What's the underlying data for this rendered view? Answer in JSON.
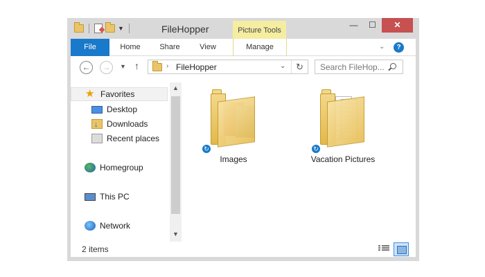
{
  "window": {
    "title": "FileHopper",
    "context_tab": "Picture Tools",
    "min_label": "—",
    "max_label": "☐",
    "close_label": "✕"
  },
  "ribbon": {
    "tabs": [
      "File",
      "Home",
      "Share",
      "View",
      "Manage"
    ],
    "expand_label": "⌄",
    "help_label": "?"
  },
  "address": {
    "path": "FileHopper",
    "search_placeholder": "Search FileHop..."
  },
  "nav": {
    "favorites": "Favorites",
    "items": [
      "Desktop",
      "Downloads",
      "Recent places"
    ],
    "homegroup": "Homegroup",
    "this_pc": "This PC",
    "network": "Network"
  },
  "content": {
    "items": [
      {
        "name": "Images",
        "icon": "picture-folder-icon"
      },
      {
        "name": "Vacation Pictures",
        "icon": "documents-folder-icon"
      }
    ]
  },
  "status": {
    "item_count": "2 items"
  },
  "colors": {
    "file_tab": "#1979ca",
    "context_tab": "#f5eda0",
    "close_button": "#c75050"
  }
}
